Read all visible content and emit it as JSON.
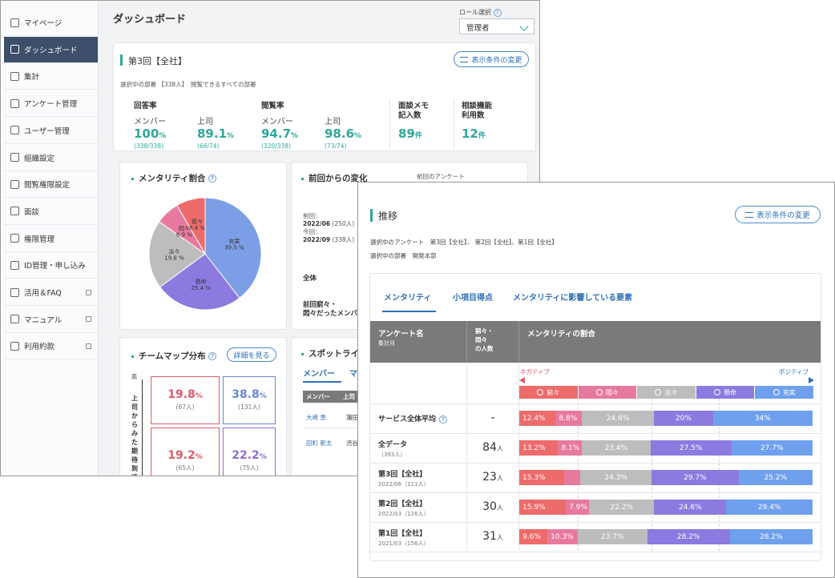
{
  "dashboard": {
    "sidebar": [
      {
        "label": "マイページ",
        "icon": "home-icon"
      },
      {
        "label": "ダッシュボード",
        "icon": "dashboard-icon",
        "active": true
      },
      {
        "label": "集計",
        "icon": "bar-chart-icon"
      },
      {
        "label": "アンケート管理",
        "icon": "edit-icon"
      },
      {
        "label": "ユーザー管理",
        "icon": "user-icon"
      },
      {
        "label": "組織設定",
        "icon": "org-icon"
      },
      {
        "label": "閲覧権限設定",
        "icon": "permission-icon"
      },
      {
        "label": "面談",
        "icon": "interview-icon"
      },
      {
        "label": "権限管理",
        "icon": "gear-icon"
      },
      {
        "label": "ID管理・申し込み",
        "icon": "layers-icon"
      },
      {
        "label": "活用＆FAQ",
        "icon": "book-icon",
        "external": true
      },
      {
        "label": "マニュアル",
        "icon": "manual-icon",
        "external": true
      },
      {
        "label": "利用約款",
        "icon": "document-icon",
        "external": true
      }
    ],
    "title": "ダッシュボード",
    "role_label": "ロール選択",
    "role_value": "管理者",
    "survey_title": "第3回【全社】",
    "filter_button": "表示条件の変更",
    "dept_line": "選択中の部署 【338人】　閲覧できるすべての部署",
    "kpis": {
      "answer_rate": "回答率",
      "view_rate": "閲覧率",
      "member": "メンバー",
      "boss": "上司",
      "answer_member": "100",
      "answer_member_note": "(338/338)",
      "answer_boss": "89.1",
      "answer_boss_note": "(66/74)",
      "view_member": "94.7",
      "view_member_note": "(320/338)",
      "view_boss": "98.6",
      "view_boss_note": "(73/74)",
      "pct_unit": "%",
      "memo_label_1": "面談メモ",
      "memo_label_2": "記入数",
      "memo_value": "89",
      "consult_label_1": "相談機能",
      "consult_label_2": "利用数",
      "consult_value": "12",
      "count_unit": "件"
    },
    "mentality_title": "メンタリティ割合",
    "pie": {
      "type": "pie",
      "slices": [
        {
          "label": "充実",
          "value": 39.5,
          "color": "#7c9ee6"
        },
        {
          "label": "懸命",
          "value": 25.4,
          "color": "#8c7ae0"
        },
        {
          "label": "淡々",
          "value": 19.8,
          "color": "#bdbdbd"
        },
        {
          "label": "悶々",
          "value": 6.9,
          "color": "#e8799e"
        },
        {
          "label": "窮々",
          "value": 8.4,
          "color": "#ee6b6b"
        }
      ],
      "labels": [
        {
          "text": "充実",
          "value": "39.5 %"
        },
        {
          "text": "懸命",
          "value": "25.4 %"
        },
        {
          "text": "淡々",
          "value": "19.8 %"
        },
        {
          "text": "悶々",
          "value": "6.9 %"
        },
        {
          "text": "窮々",
          "value": "8.4 %"
        }
      ]
    },
    "change_title": "前回からの変化",
    "prev_survey_label": "前回のアンケート",
    "prev_label": "前回：",
    "prev_date": "2022/06",
    "prev_count": "(250人)",
    "now_label": "今回：",
    "now_date": "2022/09",
    "now_count": "(338人)",
    "all_label": "全体",
    "prev_kyu_1": "前回窮々・",
    "prev_kyu_2": "悶々だったメンバ",
    "teammap_title": "チームマップ分布",
    "teammap_button": "詳細を見る",
    "teammap_axis": "上司からみた期待到達度",
    "teammap_high": "高",
    "teammap": [
      {
        "pct": "19.8",
        "count": "(67人)",
        "color": "#e05a6a"
      },
      {
        "pct": "38.8",
        "count": "(131人)",
        "color": "#6a87d8"
      },
      {
        "pct": "19.2",
        "count": "(65人)",
        "color": "#e05a6a"
      },
      {
        "pct": "22.2",
        "count": "(75人)",
        "color": "#8c6fd6"
      }
    ],
    "spotlight_title": "スポットライ",
    "spotlight_tab": "メンバー",
    "spotlight_tab2": "マ",
    "spotlight_head": [
      "メンバー",
      "上司"
    ],
    "spotlight_rows": [
      {
        "member": "大崎 恵",
        "boss": "蒲田"
      },
      {
        "member": "田町 新太",
        "boss": "渋谷"
      }
    ]
  },
  "trend": {
    "title": "推移",
    "filter_button": "表示条件の変更",
    "survey_line_label": "選択中のアンケート",
    "survey_line_value": "第3回【全社】、 第2回【全社】、第1回【全社】",
    "dept_line_label": "選択中の部署",
    "dept_line_value": "開発本部",
    "tabs": [
      "メンタリティ",
      "小項目得点",
      "メンタリティに影響している要素"
    ],
    "head": {
      "survey": "アンケート名",
      "month": "集計月",
      "count_1": "窮々・",
      "count_2": "悶々",
      "count_3": "の人数",
      "ratio": "メンタリティの割合"
    },
    "negative": "ネガティブ",
    "positive": "ポジティブ",
    "legend": [
      {
        "label": "窮々",
        "color": "#ee6b6b"
      },
      {
        "label": "悶々",
        "color": "#e8799e"
      },
      {
        "label": "淡々",
        "color": "#bdbdbd"
      },
      {
        "label": "懸命",
        "color": "#8c7ae0"
      },
      {
        "label": "充実",
        "color": "#6fa0ee"
      }
    ],
    "rows": [
      {
        "name": "サービス全体平均",
        "sub": "",
        "count": "-",
        "unit": "",
        "help": true,
        "values": [
          12.4,
          8.8,
          24.8,
          20,
          34
        ],
        "labels": [
          "12.4%",
          "8.8%",
          "24.8%",
          "20%",
          "34%"
        ]
      },
      {
        "name": "全データ",
        "sub": "（393人）",
        "count": "84",
        "unit": "人",
        "values": [
          13.2,
          8.1,
          23.4,
          27.5,
          27.7
        ],
        "labels": [
          "13.2%",
          "8.1%",
          "23.4%",
          "27.5%",
          "27.7%"
        ]
      },
      {
        "name": "第3回【全社】",
        "sub": "2022/06（111人）",
        "count": "23",
        "unit": "人",
        "values": [
          15.3,
          5.5,
          24.3,
          29.7,
          25.2
        ],
        "labels": [
          "15.3%",
          "",
          "24.3%",
          "29.7%",
          "25.2%"
        ]
      },
      {
        "name": "第2回【全社】",
        "sub": "2022/03（126人）",
        "count": "30",
        "unit": "人",
        "values": [
          15.9,
          7.9,
          22.2,
          24.6,
          29.4
        ],
        "labels": [
          "15.9%",
          "7.9%",
          "22.2%",
          "24.6%",
          "29.4%"
        ]
      },
      {
        "name": "第1回【全社】",
        "sub": "2021/03（156人）",
        "count": "31",
        "unit": "人",
        "values": [
          9.6,
          10.3,
          23.7,
          28.2,
          28.2
        ],
        "labels": [
          "9.6%",
          "10.3%",
          "23.7%",
          "28.2%",
          "28.2%"
        ]
      }
    ]
  }
}
